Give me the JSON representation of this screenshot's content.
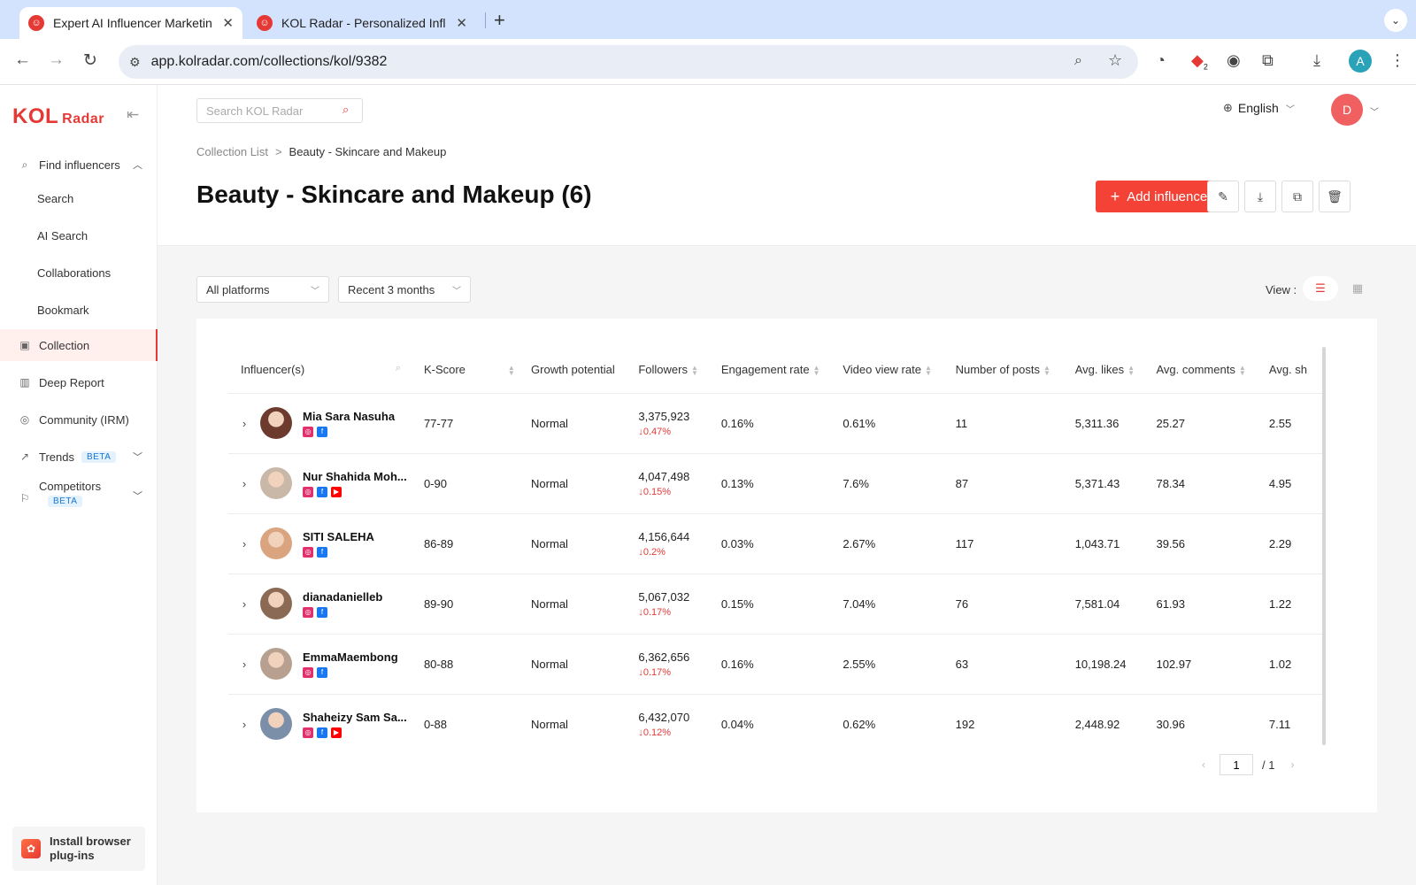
{
  "browser": {
    "tabs": [
      {
        "title": "Expert AI Influencer Marketing",
        "active": true
      },
      {
        "title": "KOL Radar - Personalized Influencer",
        "active": false
      }
    ],
    "url": "app.kolradar.com/collections/kol/9382",
    "profile_initial": "A",
    "ext_badge": "2"
  },
  "sidebar": {
    "logo_main": "KOL",
    "logo_sub": "Radar",
    "find_influencers": "Find influencers",
    "sub_items": [
      "Search",
      "AI Search",
      "Collaborations",
      "Bookmark"
    ],
    "collection": "Collection",
    "deep_report": "Deep Report",
    "community": "Community (IRM)",
    "trends": "Trends",
    "competitors": "Competitors",
    "beta": "BETA",
    "plugin": "Install browser plug-ins"
  },
  "header": {
    "search_placeholder": "Search KOL Radar",
    "language": "English",
    "user_initial": "D"
  },
  "breadcrumb": {
    "root": "Collection List",
    "sep": ">",
    "current": "Beauty - Skincare and Makeup"
  },
  "page_title": "Beauty - Skincare and Makeup (6)",
  "add_button": "Add influencer",
  "filters": {
    "platform": "All platforms",
    "period": "Recent 3 months"
  },
  "view_label": "View :",
  "columns": [
    "Influencer(s)",
    "K-Score",
    "Growth potential",
    "Followers",
    "Engagement rate",
    "Video view rate",
    "Number of posts",
    "Avg. likes",
    "Avg. comments",
    "Avg. sh"
  ],
  "rows": [
    {
      "name": "Mia Sara Nasuha",
      "platforms": [
        "ig",
        "fb"
      ],
      "kscore": "77-77",
      "growth": "Normal",
      "followers": "3,375,923",
      "change": "↓0.47%",
      "er": "0.16%",
      "vvr": "0.61%",
      "posts": "11",
      "likes": "5,311.36",
      "comments": "25.27",
      "shares": "2.55"
    },
    {
      "name": "Nur Shahida Moh...",
      "platforms": [
        "ig",
        "fb",
        "yt"
      ],
      "kscore": "0-90",
      "growth": "Normal",
      "followers": "4,047,498",
      "change": "↓0.15%",
      "er": "0.13%",
      "vvr": "7.6%",
      "posts": "87",
      "likes": "5,371.43",
      "comments": "78.34",
      "shares": "4.95"
    },
    {
      "name": "SITI SALEHA",
      "platforms": [
        "ig",
        "fb"
      ],
      "kscore": "86-89",
      "growth": "Normal",
      "followers": "4,156,644",
      "change": "↓0.2%",
      "er": "0.03%",
      "vvr": "2.67%",
      "posts": "117",
      "likes": "1,043.71",
      "comments": "39.56",
      "shares": "2.29"
    },
    {
      "name": "dianadanielleb",
      "platforms": [
        "ig",
        "fb"
      ],
      "kscore": "89-90",
      "growth": "Normal",
      "followers": "5,067,032",
      "change": "↓0.17%",
      "er": "0.15%",
      "vvr": "7.04%",
      "posts": "76",
      "likes": "7,581.04",
      "comments": "61.93",
      "shares": "1.22"
    },
    {
      "name": "EmmaMaembong",
      "platforms": [
        "ig",
        "fb"
      ],
      "kscore": "80-88",
      "growth": "Normal",
      "followers": "6,362,656",
      "change": "↓0.17%",
      "er": "0.16%",
      "vvr": "2.55%",
      "posts": "63",
      "likes": "10,198.24",
      "comments": "102.97",
      "shares": "1.02"
    },
    {
      "name": "Shaheizy Sam Sa...",
      "platforms": [
        "ig",
        "fb",
        "yt"
      ],
      "kscore": "0-88",
      "growth": "Normal",
      "followers": "6,432,070",
      "change": "↓0.12%",
      "er": "0.04%",
      "vvr": "0.62%",
      "posts": "192",
      "likes": "2,448.92",
      "comments": "30.96",
      "shares": "7.11"
    }
  ],
  "pager": {
    "current": "1",
    "total": "/ 1"
  },
  "icons": {
    "platform_ig": "instagram-icon",
    "platform_fb": "facebook-icon",
    "platform_yt": "youtube-icon"
  },
  "colors": {
    "accent": "#f44336",
    "down": "#e53935"
  }
}
